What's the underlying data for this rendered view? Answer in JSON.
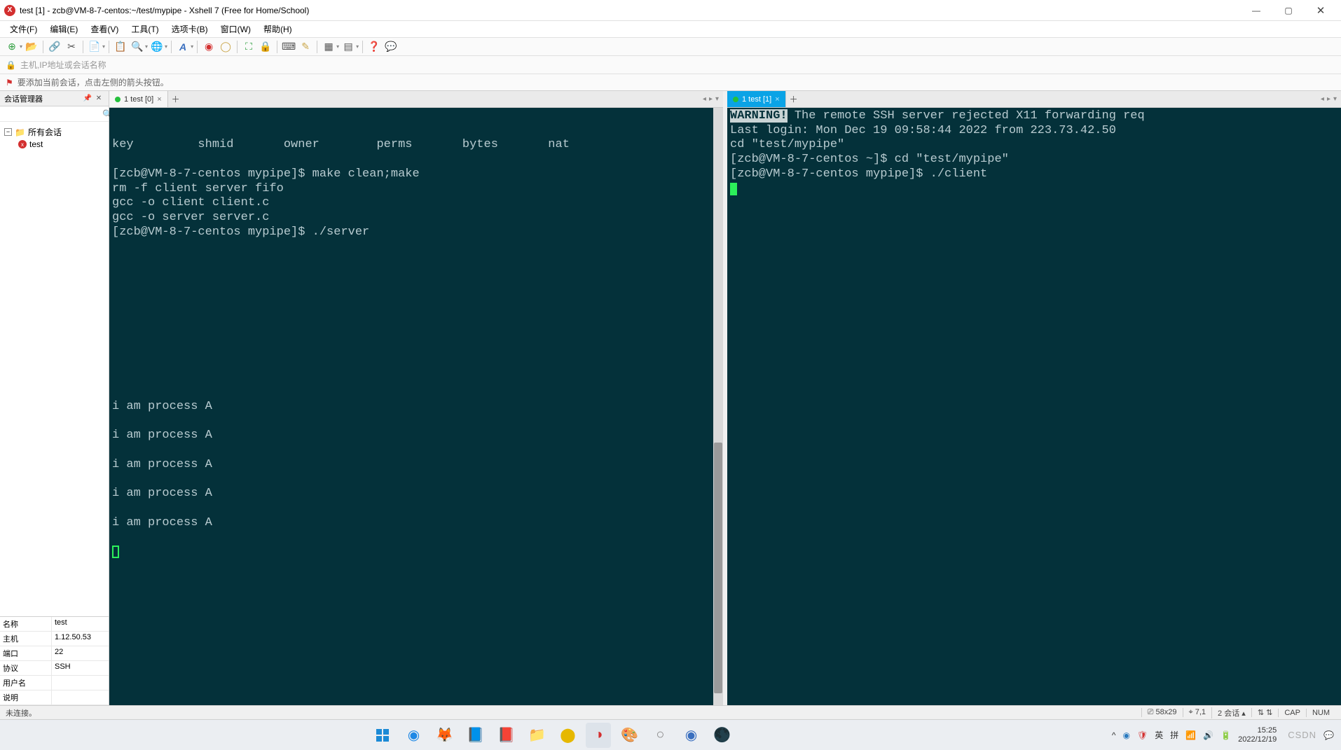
{
  "window": {
    "title": "test [1] - zcb@VM-8-7-centos:~/test/mypipe - Xshell 7 (Free for Home/School)"
  },
  "menus": [
    "文件(F)",
    "编辑(E)",
    "查看(V)",
    "工具(T)",
    "选项卡(B)",
    "窗口(W)",
    "帮助(H)"
  ],
  "addressbar": {
    "placeholder": "主机,IP地址或会话名称"
  },
  "hintbar": {
    "text": "要添加当前会话，点击左侧的箭头按钮。"
  },
  "sidebar": {
    "title": "会话管理器",
    "root_label": "所有会话",
    "session_label": "test",
    "props": [
      {
        "label": "名称",
        "value": "test"
      },
      {
        "label": "主机",
        "value": "1.12.50.53"
      },
      {
        "label": "端口",
        "value": "22"
      },
      {
        "label": "协议",
        "value": "SSH"
      },
      {
        "label": "用户名",
        "value": ""
      },
      {
        "label": "说明",
        "value": ""
      }
    ]
  },
  "left_pane": {
    "tab_label": "1 test [0]",
    "lines": [
      "key         shmid       owner        perms       bytes       nat",
      "",
      "[zcb@VM-8-7-centos mypipe]$ make clean;make",
      "rm -f client server fifo",
      "gcc -o client client.c",
      "gcc -o server server.c",
      "[zcb@VM-8-7-centos mypipe]$ ./server",
      "",
      "",
      "",
      "",
      "",
      "",
      "",
      "",
      "",
      "",
      "",
      "i am process A",
      "",
      "i am process A",
      "",
      "i am process A",
      "",
      "i am process A",
      "",
      "i am process A",
      ""
    ]
  },
  "right_pane": {
    "tab_label": "1 test [1]",
    "warning_label": "WARNING!",
    "warning_rest": " The remote SSH server rejected X11 forwarding req",
    "lines": [
      "Last login: Mon Dec 19 09:58:44 2022 from 223.73.42.50",
      "cd \"test/mypipe\"",
      "[zcb@VM-8-7-centos ~]$ cd \"test/mypipe\"",
      "[zcb@VM-8-7-centos mypipe]$ ./client"
    ]
  },
  "statusbar": {
    "left": "未连接。",
    "dims": "58x29",
    "cursor": "7,1",
    "sessions": "2 会话",
    "caps": "CAP",
    "num": "NUM"
  },
  "taskbar": {
    "time": "15:25",
    "date": "2022/12/19",
    "ime1": "英",
    "ime2": "拼",
    "watermark": "CSDN"
  }
}
